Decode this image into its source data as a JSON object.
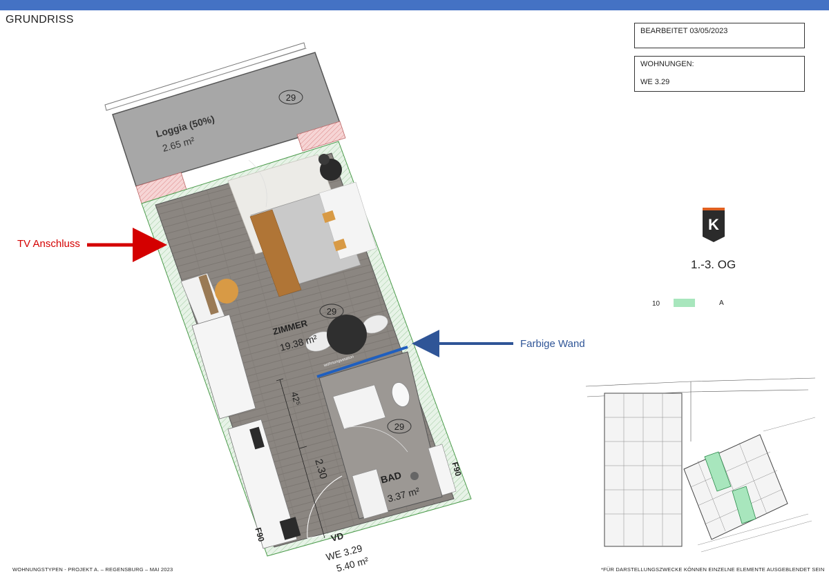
{
  "header": {
    "title": "GRUNDRISS"
  },
  "info": {
    "edited": "BEARBEITET 03/05/2023",
    "units_label": "WOHNUNGEN:",
    "units_value": "WE 3.29"
  },
  "logo": {
    "letter": "K"
  },
  "floor": {
    "label": "1.-3. OG"
  },
  "legend": {
    "number": "10",
    "label": "A",
    "color": "#a8e6bd"
  },
  "annotations": {
    "tv": "TV Anschluss",
    "wall": "Farbige Wand",
    "tv_color": "#d40000",
    "wall_color": "#2f5597"
  },
  "plan": {
    "loggia_name": "Loggia (50%)",
    "loggia_area": "2.65 m²",
    "room_number": "29",
    "zimmer_name": "ZIMMER",
    "zimmer_area": "19.38 m²",
    "bad_name": "BAD",
    "bad_area": "3.37 m²",
    "fire_rating": "F90",
    "vd": "VD",
    "unit": "WE 3.29",
    "unit_area": "5.40 m²",
    "dim_width": "2.30",
    "dim_height": "42⁵",
    "wall_text": "wohnungsstation"
  },
  "footer": {
    "left": "WOHNUNGSTYPEN - PROJEKT A. – REGENSBURG – MAI 2023",
    "right": "*FÜR DARSTELLUNGSZWECKE KÖNNEN EINZELNE ELEMENTE AUSGEBLENDET SEIN"
  }
}
